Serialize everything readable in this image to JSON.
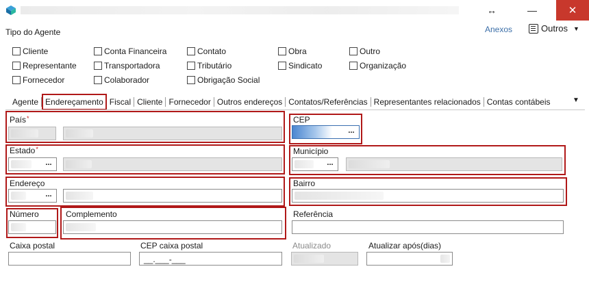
{
  "window": {
    "title": ""
  },
  "header": {
    "tipo_label": "Tipo do Agente",
    "anexos": "Anexos",
    "outros": "Outros"
  },
  "checkboxes": {
    "cliente": "Cliente",
    "representante": "Representante",
    "fornecedor": "Fornecedor",
    "conta_financeira": "Conta Financeira",
    "transportadora": "Transportadora",
    "colaborador": "Colaborador",
    "contato": "Contato",
    "tributario": "Tributário",
    "obrigacao_social": "Obrigação Social",
    "obra": "Obra",
    "sindicato": "Sindicato",
    "outro": "Outro",
    "organizacao": "Organização"
  },
  "tabs": [
    "Agente",
    "Endereçamento",
    "Fiscal",
    "Cliente",
    "Fornecedor",
    "Outros endereços",
    "Contatos/Referências",
    "Representantes relacionados",
    "Contas contábeis"
  ],
  "fields": {
    "pais": "País",
    "cep": "CEP",
    "estado": "Estado",
    "municipio": "Município",
    "endereco": "Endereço",
    "bairro": "Bairro",
    "numero": "Número",
    "complemento": "Complemento",
    "referencia": "Referência",
    "caixa_postal": "Caixa postal",
    "cep_caixa_postal": "CEP caixa postal",
    "cep_caixa_postal_mask": "__.___-___",
    "atualizado": "Atualizado",
    "atualizar_apos": "Atualizar após(dias)",
    "required_mark": "*",
    "dots": "..."
  },
  "colors": {
    "highlight": "#b01818",
    "link": "#3c6fa8",
    "close": "#c8382c"
  }
}
